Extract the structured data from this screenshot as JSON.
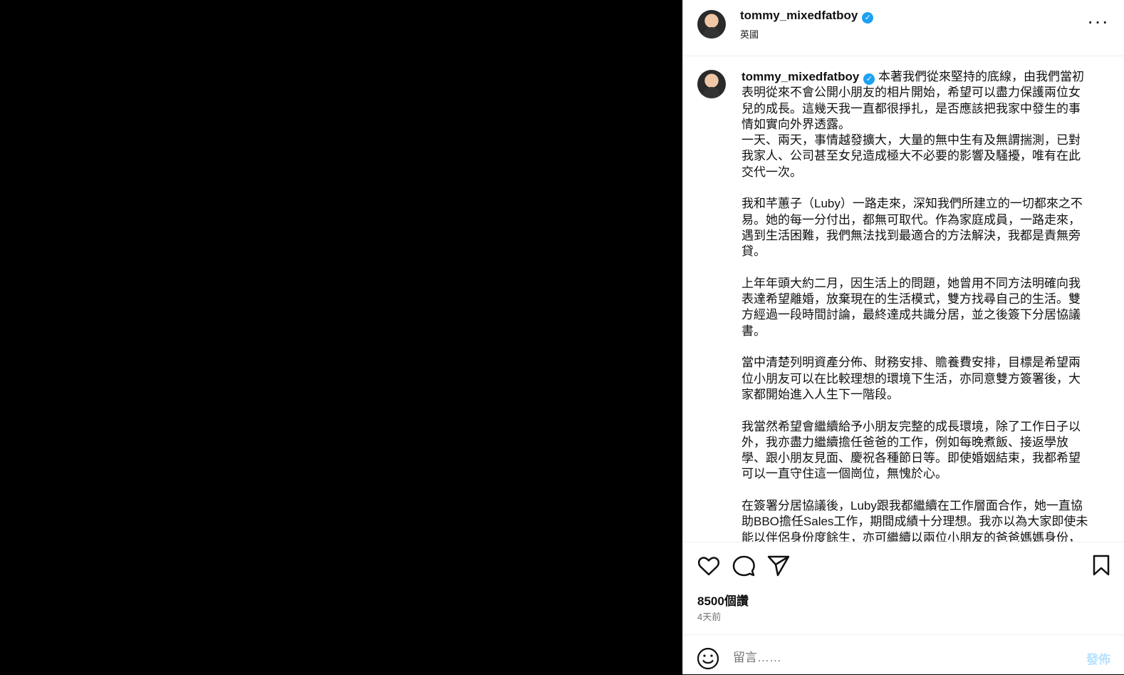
{
  "post": {
    "username": "tommy_mixedfatboy",
    "location": "英國",
    "more_icon": "···",
    "caption_text": " 本著我們從來堅持的底線，由我們當初表明從來不會公開小朋友的相片開始，希望可以盡力保護兩位女兒的成長。這幾天我一直都很掙扎，是否應該把我家中發生的事情如實向外界透露。\n一天、兩天，事情越發擴大，大量的無中生有及無謂揣測，已對我家人、公司甚至女兒造成極大不必要的影響及騷擾，唯有在此交代一次。\n\n我和芊蕙子（Luby）一路走來，深知我們所建立的一切都來之不易。她的每一分付出，都無可取代。作為家庭成員，一路走來，遇到生活困難，我們無法找到最適合的方法解決，我都是責無旁貸。\n\n上年年頭大約二月，因生活上的問題，她曾用不同方法明確向我表達希望離婚，放棄現在的生活模式，雙方找尋自己的生活。雙方經過一段時間討論，最終達成共識分居，並之後簽下分居協議書。\n\n當中清楚列明資產分佈、財務安排、贍養費安排，目標是希望兩位小朋友可以在比較理想的環境下生活，亦同意雙方簽署後，大家都開始進入人生下一階段。\n\n我當然希望會繼續給予小朋友完整的成長環境，除了工作日子以外，我亦盡力繼續擔任爸爸的工作，例如每晚煮飯、接返學放學、跟小朋友見面、慶祝各種節日等。即使婚姻結束，我都希望可以一直守住這一個崗位，無愧於心。\n\n在簽署分居協議後，Luby跟我都繼續在工作層面合作，她一直協助BBO擔任Sales工作，期間成績十分理想。我亦以為大家即使未能以伴侶身份度餘生，亦可繼續以兩位小朋友的爸爸媽媽身份，",
    "likes": "8500個讚",
    "time": "4天前",
    "comment_placeholder": "留言……",
    "post_button": "發佈"
  },
  "icons": {
    "verified": "verified-icon",
    "like": "heart-icon",
    "comment": "comment-icon",
    "share": "send-icon",
    "save": "bookmark-icon",
    "emoji": "emoji-icon"
  },
  "colors": {
    "verified": "#1da1f2",
    "post_disabled": "#b7e1ff"
  }
}
